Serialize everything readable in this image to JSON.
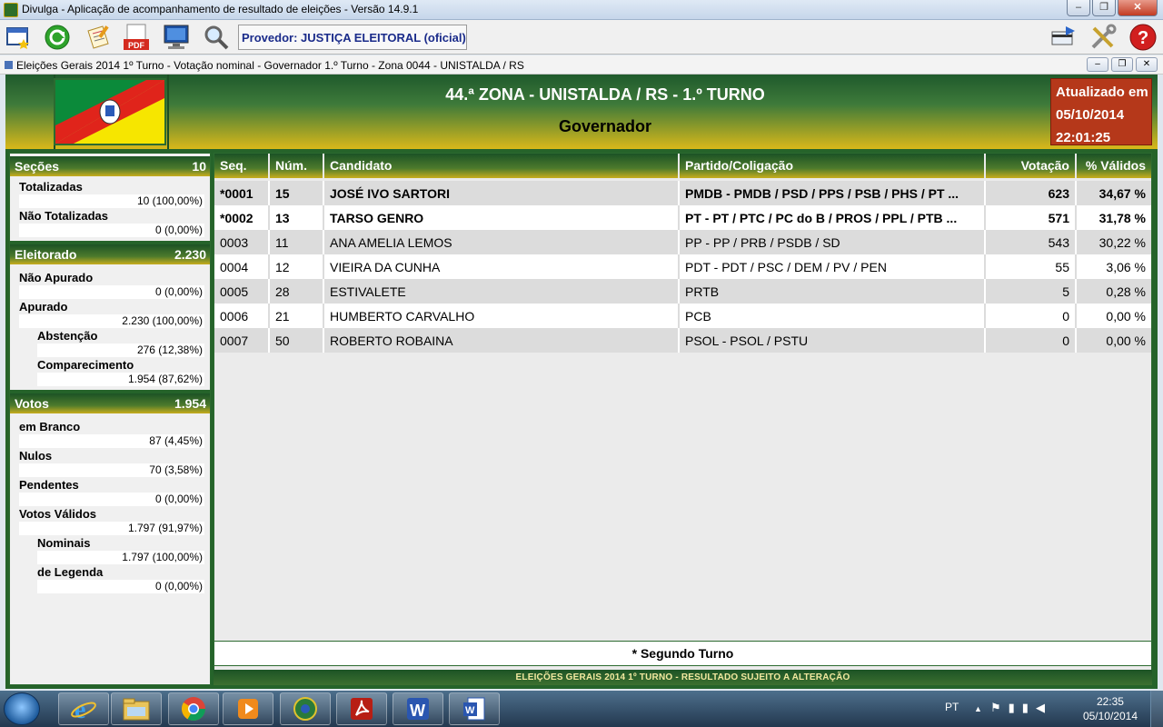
{
  "window": {
    "title": "Divulga - Aplicação de acompanhamento de resultado de eleições - Versão 14.9.1",
    "minimize": "–",
    "maximize": "❐",
    "close": "✕"
  },
  "toolbar": {
    "provider": "Provedor: JUSTIÇA ELEITORAL (oficial)",
    "icons": [
      "new-window-icon",
      "refresh-icon",
      "report-icon",
      "pdf-icon",
      "monitor-icon",
      "search-icon",
      "card-icon",
      "tools-icon",
      "help-icon"
    ],
    "pdf_text": "PDF"
  },
  "subwindow": {
    "title": "Eleições Gerais 2014 1º Turno - Votação nominal - Governador 1.º Turno - Zona 0044 - UNISTALDA / RS"
  },
  "header": {
    "zone": "44.ª ZONA - UNISTALDA / RS - 1.º TURNO",
    "office": "Governador",
    "updated_label": "Atualizado em",
    "updated_date": "05/10/2014",
    "updated_time": "22:01:25",
    "flag_colors": {
      "green": "#0b8a3a",
      "red": "#e0241b",
      "yellow": "#f6e600"
    }
  },
  "left": {
    "secoes": {
      "label": "Seções",
      "value": "10",
      "totalizadas_label": "Totalizadas",
      "totalizadas": "10 (100,00%)",
      "nao_totalizadas_label": "Não Totalizadas",
      "nao_totalizadas": "0 (0,00%)"
    },
    "eleitorado": {
      "label": "Eleitorado",
      "value": "2.230",
      "nao_apurado_label": "Não Apurado",
      "nao_apurado": "0 (0,00%)",
      "apurado_label": "Apurado",
      "apurado": "2.230 (100,00%)",
      "abstencao_label": "Abstenção",
      "abstencao": "276 (12,38%)",
      "comparecimento_label": "Comparecimento",
      "comparecimento": "1.954 (87,62%)"
    },
    "votos": {
      "label": "Votos",
      "value": "1.954",
      "branco_label": "em Branco",
      "branco": "87 (4,45%)",
      "nulos_label": "Nulos",
      "nulos": "70 (3,58%)",
      "pendentes_label": "Pendentes",
      "pendentes": "0 (0,00%)",
      "validos_label": "Votos Válidos",
      "validos": "1.797 (91,97%)",
      "nominais_label": "Nominais",
      "nominais": "1.797 (100,00%)",
      "legenda_label": "de Legenda",
      "legenda": "0 (0,00%)"
    }
  },
  "table": {
    "headers": {
      "seq": "Seq.",
      "num": "Núm.",
      "candidato": "Candidato",
      "partido": "Partido/Coligação",
      "votacao": "Votação",
      "validos": "% Válidos"
    },
    "rows": [
      {
        "seq": "*0001",
        "num": "15",
        "candidato": "JOSÉ IVO SARTORI",
        "partido": "PMDB - PMDB / PSD / PPS / PSB / PHS / PT ...",
        "votacao": "623",
        "validos": "34,67 %"
      },
      {
        "seq": "*0002",
        "num": "13",
        "candidato": "TARSO GENRO",
        "partido": "PT - PT / PTC / PC do B / PROS / PPL / PTB ...",
        "votacao": "571",
        "validos": "31,78 %"
      },
      {
        "seq": "0003",
        "num": "11",
        "candidato": "ANA AMELIA LEMOS",
        "partido": "PP - PP / PRB / PSDB / SD",
        "votacao": "543",
        "validos": "30,22 %"
      },
      {
        "seq": "0004",
        "num": "12",
        "candidato": "VIEIRA DA CUNHA",
        "partido": "PDT - PDT / PSC / DEM / PV / PEN",
        "votacao": "55",
        "validos": "3,06 %"
      },
      {
        "seq": "0005",
        "num": "28",
        "candidato": "ESTIVALETE",
        "partido": "PRTB",
        "votacao": "5",
        "validos": "0,28 %"
      },
      {
        "seq": "0006",
        "num": "21",
        "candidato": "HUMBERTO CARVALHO",
        "partido": "PCB",
        "votacao": "0",
        "validos": "0,00 %"
      },
      {
        "seq": "0007",
        "num": "50",
        "candidato": "ROBERTO ROBAINA",
        "partido": "PSOL - PSOL / PSTU",
        "votacao": "0",
        "validos": "0,00 %"
      }
    ]
  },
  "note": "* Segundo Turno",
  "footer": "ELEIÇÕES GERAIS 2014 1º TURNO - RESULTADO SUJEITO A ALTERAÇÃO",
  "taskbar": {
    "lang": "PT",
    "time": "22:35",
    "date": "05/10/2014",
    "apps": [
      "ie-icon",
      "explorer-icon",
      "chrome-icon",
      "media-player-icon",
      "divulga-icon",
      "acrobat-icon",
      "word-icon",
      "word-doc-icon"
    ]
  }
}
